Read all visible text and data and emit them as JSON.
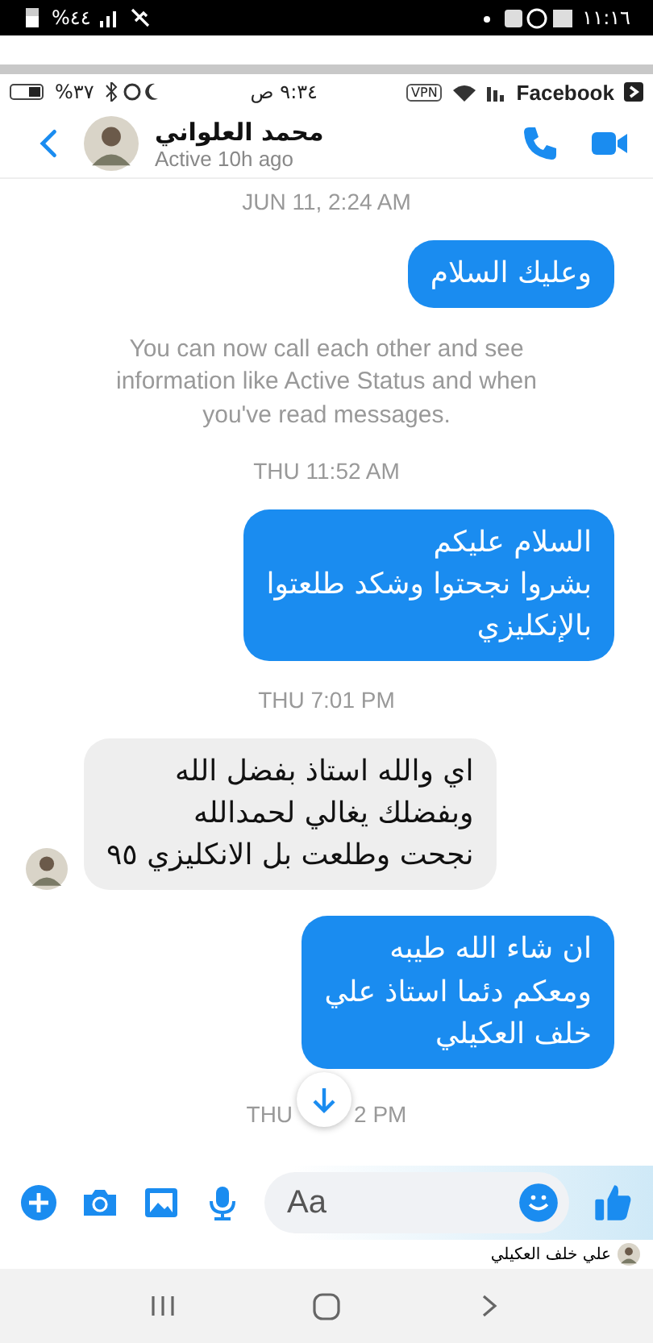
{
  "phone_status_bar": {
    "battery": "%٤٤",
    "time": "١١:١٦"
  },
  "screenshot_status_bar": {
    "battery": "%٣٧",
    "time": "٩:٣٤ ص",
    "vpn": "VPN",
    "app": "Facebook"
  },
  "header": {
    "name": "محمد العلواني",
    "status": "Active 10h ago"
  },
  "messages": [
    {
      "kind": "timestamp",
      "text": "JUN 11, 2:24 AM"
    },
    {
      "kind": "sent",
      "text": "وعليك السلام"
    },
    {
      "kind": "notice",
      "text": "You can now call each other and see information like Active Status and when you've read messages."
    },
    {
      "kind": "timestamp",
      "text": "THU 11:52 AM"
    },
    {
      "kind": "sent",
      "text": "السلام عليكم\nبشروا نجحتوا وشكد طلعتوا\nبالإنكليزي"
    },
    {
      "kind": "timestamp",
      "text": "THU 7:01 PM"
    },
    {
      "kind": "received",
      "text": "اي والله استاذ بفضل الله\nوبفضلك يغالي لحمدالله\nنجحت وطلعت بل الانكليزي ٩٥"
    },
    {
      "kind": "sent",
      "text": "ان شاء الله طيبه\nومعكم دئما استاذ علي\nخلف العكيلي"
    }
  ],
  "covered_timestamp": {
    "before": "THU",
    "after": "2 PM"
  },
  "composer": {
    "placeholder": "Aa"
  },
  "comment_preview": {
    "text": "علي خلف العكيلي"
  }
}
